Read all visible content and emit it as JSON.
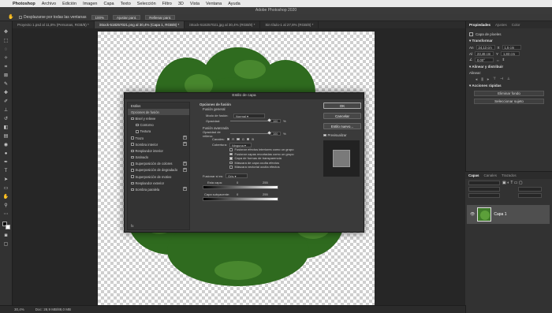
{
  "menubar": {
    "items": [
      "Photoshop",
      "Archivo",
      "Edición",
      "Imagen",
      "Capa",
      "Texto",
      "Selección",
      "Filtro",
      "3D",
      "Vista",
      "Ventana",
      "Ayuda"
    ]
  },
  "window_title": "Adobe Photoshop 2020",
  "options_bar": {
    "scroll_all": "Desplazarse por todas las ventanas",
    "zoom": "100%",
    "fit_screen": "Ajustar pant.",
    "fill_screen": "Rellenar pant."
  },
  "doc_tabs": [
    {
      "label": "Proyecto 1.psd al 11,8% (Personas, RGB/8) *"
    },
    {
      "label": "iStock-518257021.png al 30,4% (Capa 1, RGB/8) *"
    },
    {
      "label": "iStock-518257021.jpg al 30,4% (RGB/8) *"
    },
    {
      "label": "Sin título-1 al 27,8% (RGB/8) *"
    }
  ],
  "status": {
    "zoom": "30,4%",
    "doc_size": "Doc: 28,9 MB/88,0 MB"
  },
  "right_panel": {
    "tabs": [
      "Propiedades",
      "Ajustes",
      "Color"
    ],
    "pixel_layer": "Capa de píxeles",
    "transform_heading": "Transformar",
    "w": "24,13 cm",
    "h": "23,46 cm",
    "x": "1,5 cm",
    "y": "1,83 cm",
    "angle": "0,00°",
    "align_heading": "Alinear y distribuir",
    "align_sub": "Alinear:",
    "quick_heading": "Acciones rápidas",
    "remove_bg": "Eliminar fondo",
    "select_subject": "Seleccionar sujeto"
  },
  "layers_panel": {
    "tabs": [
      "Capas",
      "Canales",
      "Trazados"
    ],
    "layer_name": "Capa 1"
  },
  "dialog": {
    "title": "Estilo de capa",
    "styles_heading": "Estilos",
    "items": [
      {
        "label": "Opciones de fusión",
        "checkbox": false,
        "plus": false,
        "sub": false,
        "selected": true
      },
      {
        "label": "Bisel y relieve",
        "checkbox": true,
        "plus": false,
        "sub": false,
        "selected": false
      },
      {
        "label": "Contorno",
        "checkbox": true,
        "plus": false,
        "sub": true,
        "selected": false
      },
      {
        "label": "Textura",
        "checkbox": true,
        "plus": false,
        "sub": true,
        "selected": false
      },
      {
        "label": "Trazo",
        "checkbox": true,
        "plus": true,
        "sub": false,
        "selected": false
      },
      {
        "label": "Sombra interior",
        "checkbox": true,
        "plus": true,
        "sub": false,
        "selected": false
      },
      {
        "label": "Resplandor interior",
        "checkbox": true,
        "plus": false,
        "sub": false,
        "selected": false
      },
      {
        "label": "Satinado",
        "checkbox": true,
        "plus": false,
        "sub": false,
        "selected": false
      },
      {
        "label": "Superposición de colores",
        "checkbox": true,
        "plus": true,
        "sub": false,
        "selected": false
      },
      {
        "label": "Superposición de degradado",
        "checkbox": true,
        "plus": true,
        "sub": false,
        "selected": false
      },
      {
        "label": "Superposición de motivo",
        "checkbox": true,
        "plus": false,
        "sub": false,
        "selected": false
      },
      {
        "label": "Resplandor exterior",
        "checkbox": true,
        "plus": false,
        "sub": false,
        "selected": false
      },
      {
        "label": "Sombra paralela",
        "checkbox": true,
        "plus": true,
        "sub": false,
        "selected": false
      }
    ],
    "fx": "fx",
    "blend_options_heading": "Opciones de fusión",
    "general_heading": "Fusión general",
    "blend_mode_label": "Modo de fusión:",
    "blend_mode_value": "Normal",
    "opacity_label": "Opacidad:",
    "opacity_value": "100",
    "opacity_fraction": 1.0,
    "advanced_heading": "Fusión avanzada",
    "fill_opacity_label": "Opacidad de relleno:",
    "fill_opacity_value": "100",
    "fill_opacity_fraction": 1.0,
    "percent": "%",
    "channels_label": "Canales:",
    "channel_r": "R",
    "channel_g": "G",
    "channel_b": "B",
    "knockout_label": "Cobertura:",
    "knockout_value": "Ninguna",
    "checks": [
      {
        "label": "Fusionar efectos interiores como un grupo",
        "on": false
      },
      {
        "label": "Fusionar capas recortadas como un grupo",
        "on": true
      },
      {
        "label": "Capa de formas de transparencia",
        "on": true
      },
      {
        "label": "Máscara de capa oculta efectos",
        "on": false
      },
      {
        "label": "Máscara vectorial oculta efectos",
        "on": false
      }
    ],
    "blend_if_label": "Fusionar si es:",
    "blend_if_value": "Gris",
    "this_layer_label": "Esta capa:",
    "under_layer_label": "Capa subyacente:",
    "range_low": "0",
    "range_high": "255",
    "ok": "OK",
    "cancel": "Cancelar",
    "new_style": "Estilo nuevo...",
    "preview_label": "Previsualizar"
  }
}
